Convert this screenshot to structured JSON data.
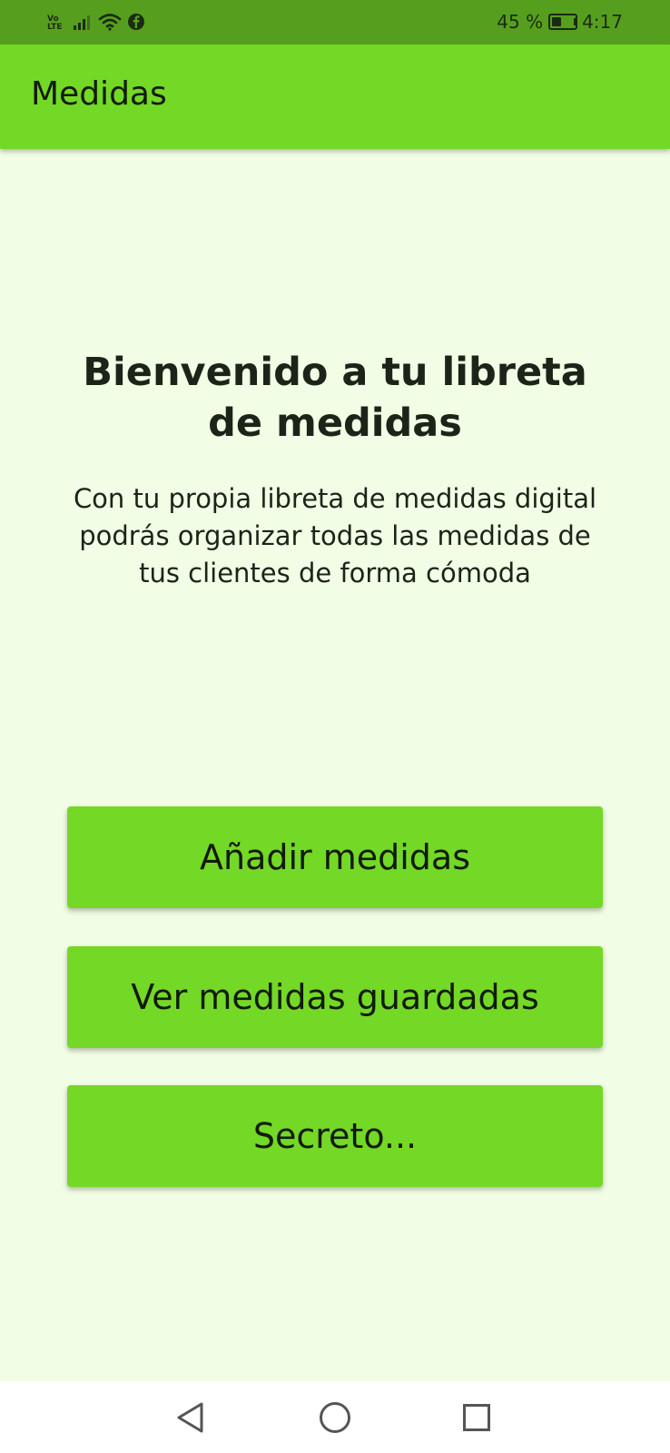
{
  "status_bar": {
    "volte_top": "Vo",
    "volte_bottom": "LTE",
    "battery_text": "45 %",
    "battery_level": 0.45,
    "time": "4:17",
    "icons": [
      "signal-icon",
      "wifi-icon",
      "facebook-icon",
      "battery-icon"
    ]
  },
  "app_bar": {
    "title": "Medidas"
  },
  "main": {
    "headline": "Bienvenido a tu libreta de medidas",
    "description": "Con tu propia libreta de medidas digital podrás organizar todas las medidas de tus clientes de forma cómoda",
    "buttons": [
      {
        "label": "Añadir medidas"
      },
      {
        "label": "Ver medidas guardadas"
      },
      {
        "label": "Secreto..."
      }
    ]
  },
  "nav_bar": {
    "icons": [
      "back-icon",
      "home-icon",
      "recents-icon"
    ]
  },
  "colors": {
    "status_bar": "#569f1e",
    "accent": "#74d826",
    "background": "#f1fde4",
    "text": "#1c2419"
  }
}
